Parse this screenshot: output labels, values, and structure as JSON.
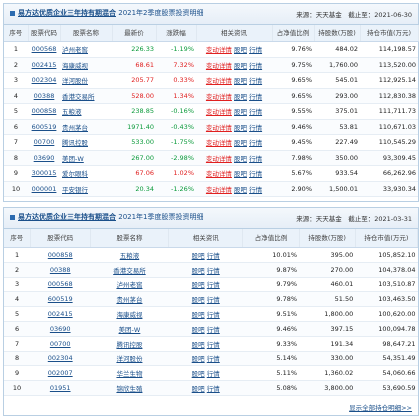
{
  "panel1": {
    "fund": "易方达优质企业三年持有期混合",
    "period": "2021年2季度股票投资明细",
    "source": "来源：天天基金　截止至：2021-06-30",
    "headers": [
      "序号",
      "股票代码",
      "股票名称",
      "最新价",
      "涨跌幅",
      "相关资讯",
      "占净值比例",
      "持股数(万股)",
      "持仓市值(万元)"
    ],
    "rows": [
      {
        "no": "1",
        "code": "000568",
        "name": "泸州老窖",
        "price": "226.33",
        "change": "-1.19%",
        "news": "变动详情 股吧 行情",
        "pct": "9.76%",
        "shares": "484.02",
        "value": "114,198.57"
      },
      {
        "no": "2",
        "code": "002415",
        "name": "海康威视",
        "price": "68.61",
        "change": "7.32%",
        "news": "变动详情 股吧 行情",
        "pct": "9.75%",
        "shares": "1,760.00",
        "value": "113,520.00"
      },
      {
        "no": "3",
        "code": "002304",
        "name": "洋河股份",
        "price": "205.77",
        "change": "0.33%",
        "news": "变动详情 股吧 行情",
        "pct": "9.65%",
        "shares": "545.01",
        "value": "112,925.14"
      },
      {
        "no": "4",
        "code": "00388",
        "name": "香港交易所",
        "price": "528.00",
        "change": "1.34%",
        "news": "变动详情 股吧 行情",
        "pct": "9.65%",
        "shares": "293.00",
        "value": "112,830.38"
      },
      {
        "no": "5",
        "code": "000858",
        "name": "五粮液",
        "price": "238.85",
        "change": "-0.16%",
        "news": "变动详情 股吧 行情",
        "pct": "9.55%",
        "shares": "375.01",
        "value": "111,711.73"
      },
      {
        "no": "6",
        "code": "600519",
        "name": "贵州茅台",
        "price": "1971.40",
        "change": "-0.43%",
        "news": "变动详情 股吧 行情",
        "pct": "9.46%",
        "shares": "53.81",
        "value": "110,671.03"
      },
      {
        "no": "7",
        "code": "00700",
        "name": "腾讯控股",
        "price": "533.00",
        "change": "-1.75%",
        "news": "变动详情 股吧 行情",
        "pct": "9.45%",
        "shares": "227.49",
        "value": "110,545.29"
      },
      {
        "no": "8",
        "code": "03690",
        "name": "美团-W",
        "price": "267.00",
        "change": "-2.98%",
        "news": "变动详情 股吧 行情",
        "pct": "7.98%",
        "shares": "350.00",
        "value": "93,309.45"
      },
      {
        "no": "9",
        "code": "300015",
        "name": "爱尔眼科",
        "price": "67.06",
        "change": "1.02%",
        "news": "变动详情 股吧 行情",
        "pct": "5.67%",
        "shares": "933.54",
        "value": "66,262.96"
      },
      {
        "no": "10",
        "code": "000001",
        "name": "平安银行",
        "price": "20.34",
        "change": "-1.26%",
        "news": "变动详情 股吧 行情",
        "pct": "2.90%",
        "shares": "1,500.01",
        "value": "33,930.34"
      }
    ]
  },
  "panel2": {
    "fund": "易方达优质企业三年持有期混合",
    "period": "2021年1季度股票投资明细",
    "source": "来源：天天基金　截止至：2021-03-31",
    "headers": [
      "序号",
      "股票代码",
      "股票名称",
      "相关资讯",
      "占净值比例",
      "持股数(万股)",
      "持仓市值(万元)"
    ],
    "rows": [
      {
        "no": "1",
        "code": "000858",
        "name": "五粮液",
        "news": "股吧 行情",
        "pct": "10.01%",
        "shares": "395.00",
        "value": "105,852.10"
      },
      {
        "no": "2",
        "code": "00388",
        "name": "香港交易所",
        "news": "股吧 行情",
        "pct": "9.87%",
        "shares": "270.00",
        "value": "104,378.04"
      },
      {
        "no": "3",
        "code": "000568",
        "name": "泸州老窖",
        "news": "股吧 行情",
        "pct": "9.79%",
        "shares": "460.01",
        "value": "103,510.87"
      },
      {
        "no": "4",
        "code": "600519",
        "name": "贵州茅台",
        "news": "股吧 行情",
        "pct": "9.78%",
        "shares": "51.50",
        "value": "103,463.50"
      },
      {
        "no": "5",
        "code": "002415",
        "name": "海康威视",
        "news": "股吧 行情",
        "pct": "9.51%",
        "shares": "1,800.00",
        "value": "100,620.00"
      },
      {
        "no": "6",
        "code": "03690",
        "name": "美团-W",
        "news": "股吧 行情",
        "pct": "9.46%",
        "shares": "397.15",
        "value": "100,094.78"
      },
      {
        "no": "7",
        "code": "00700",
        "name": "腾讯控股",
        "news": "股吧 行情",
        "pct": "9.33%",
        "shares": "191.34",
        "value": "98,647.21"
      },
      {
        "no": "8",
        "code": "002304",
        "name": "洋河股份",
        "news": "股吧 行情",
        "pct": "5.14%",
        "shares": "330.00",
        "value": "54,351.49"
      },
      {
        "no": "9",
        "code": "002007",
        "name": "华兰生物",
        "news": "股吧 行情",
        "pct": "5.11%",
        "shares": "1,360.02",
        "value": "54,060.66"
      },
      {
        "no": "10",
        "code": "01951",
        "name": "锦欣生殖",
        "news": "股吧 行情",
        "pct": "5.08%",
        "shares": "3,800.00",
        "value": "53,690.59"
      }
    ],
    "more": "显示全部持仓明细>>"
  }
}
